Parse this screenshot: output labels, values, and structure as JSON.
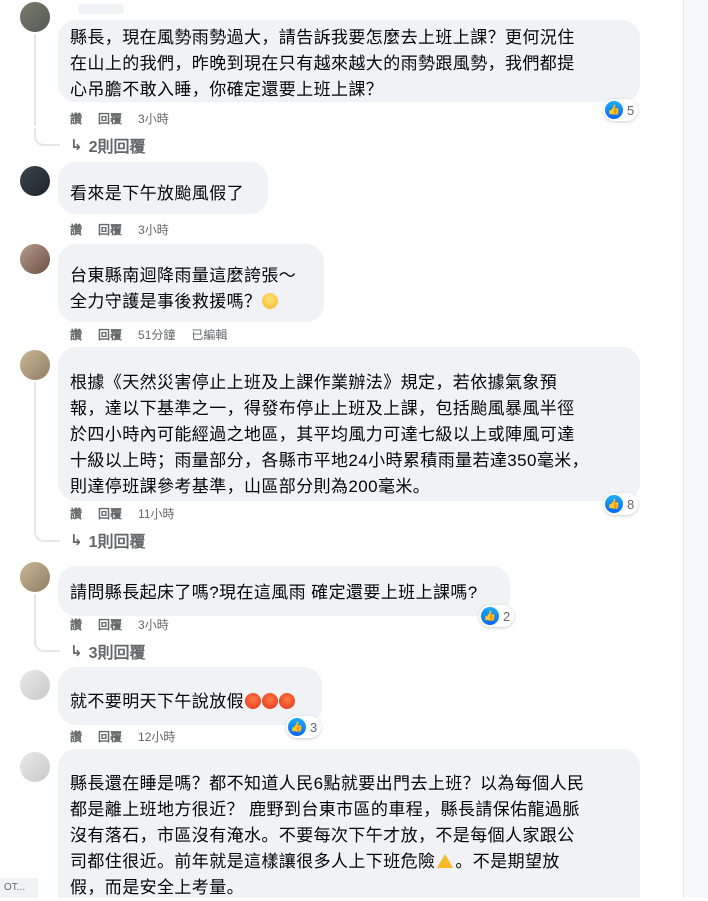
{
  "comments": [
    {
      "text": "縣長，現在風勢雨勢過大，請告訴我要怎麼去上班上課？更何況住\n在山上的我們，昨晚到現在只有越來越大的雨勢跟風勢，我們都提\n心吊膽不敢入睡，你確定還要上班上課？",
      "reactions": "5",
      "like": "讚",
      "reply": "回覆",
      "time": "3小時",
      "replies_label": "2則回覆"
    },
    {
      "text": "看來是下午放颱風假了",
      "like": "讚",
      "reply": "回覆",
      "time": "3小時"
    },
    {
      "text_line1": "台東縣南迴降雨量這麼誇張～",
      "text_line2": "全力守護是事後救援嗎？",
      "like": "讚",
      "reply": "回覆",
      "time": "51分鐘",
      "edited": "已編輯"
    },
    {
      "text": "根據《天然災害停止上班及上課作業辦法》規定，若依據氣象預\n報，達以下基準之一，得發布停止上班及上課，包括颱風暴風半徑\n於四小時內可能經過之地區，其平均風力可達七級以上或陣風可達\n十級以上時；雨量部分，各縣市平地24小時累積雨量若達350毫米，\n則達停班課參考基準，山區部分則為200毫米。",
      "reactions": "8",
      "like": "讚",
      "reply": "回覆",
      "time": "11小時",
      "replies_label": "1則回覆"
    },
    {
      "text": "請問縣長起床了嗎?現在這風雨 確定還要上班上課嗎?",
      "reactions": "2",
      "like": "讚",
      "reply": "回覆",
      "time": "3小時",
      "replies_label": "3則回覆"
    },
    {
      "text": "就不要明天下午說放假",
      "reactions": "3",
      "like": "讚",
      "reply": "回覆",
      "time": "12小時"
    },
    {
      "text_a": "縣長還在睡是嗎？都不知道人民6點就要出門去上班？以為每個人民\n都是離上班地方很近？ 鹿野到台東市區的車程，縣長請保佑龍過脈\n沒有落石，市區沒有淹水。不要每次下午才放，不是每個人家跟公\n司都住很近。前年就是這樣讓很多人上下班危險",
      "text_b": "。不是期望放\n假，而是安全上考量。"
    }
  ],
  "corner_label": "OT..."
}
